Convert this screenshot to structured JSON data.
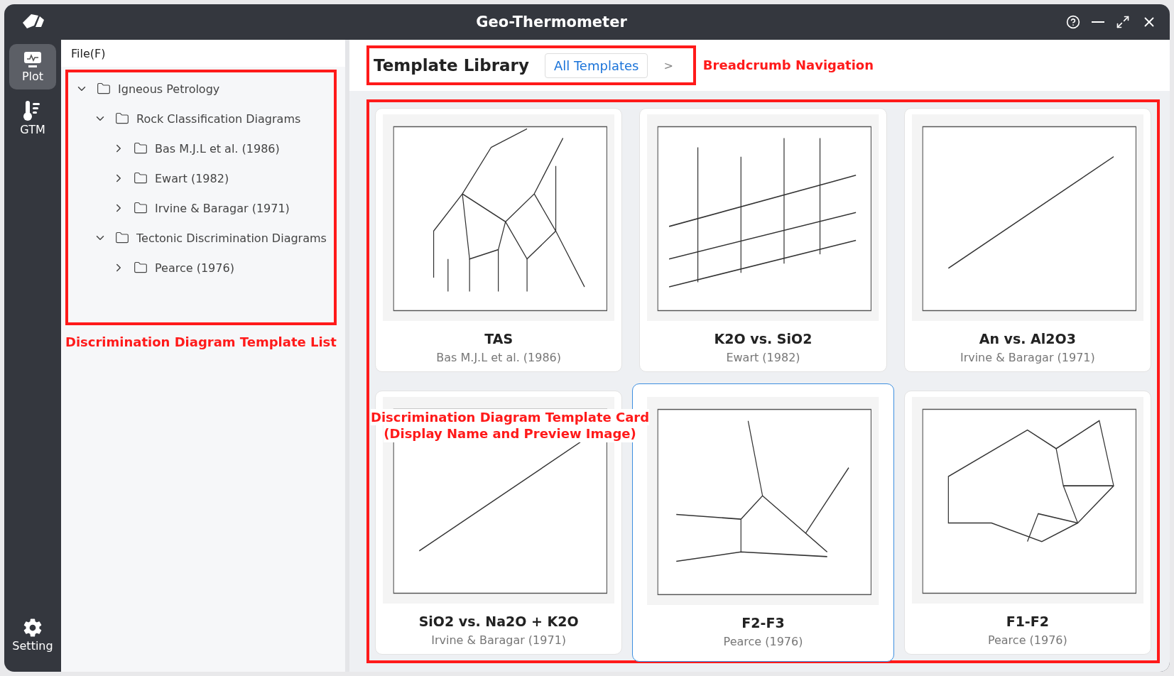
{
  "window": {
    "title": "Geo-Thermometer"
  },
  "nav": [
    {
      "label": "Plot",
      "selected": true
    },
    {
      "label": "GTM",
      "selected": false
    }
  ],
  "nav_bottom": {
    "label": "Setting"
  },
  "menu": [
    "File(F)"
  ],
  "tree": [
    {
      "label": "Igneous Petrology",
      "expanded": true,
      "children": [
        {
          "label": "Rock Classification Diagrams",
          "expanded": true,
          "children": [
            {
              "label": "Bas M.J.L et al. (1986)",
              "expanded": false
            },
            {
              "label": "Ewart (1982)",
              "expanded": false
            },
            {
              "label": "Irvine & Baragar (1971)",
              "expanded": false
            }
          ]
        },
        {
          "label": "Tectonic Discrimination Diagrams",
          "expanded": true,
          "children": [
            {
              "label": "Pearce (1976)",
              "expanded": false
            }
          ]
        }
      ]
    }
  ],
  "breadcrumb": {
    "title": "Template Library",
    "items": [
      {
        "label": "All Templates",
        "selected": true
      }
    ],
    "separator": ">"
  },
  "cards": [
    {
      "title": "TAS",
      "subtitle": "Bas M.J.L et al. (1986)",
      "kind": "tas",
      "selected": false
    },
    {
      "title": "K2O vs. SiO2",
      "subtitle": "Ewart (1982)",
      "kind": "k2o",
      "selected": false
    },
    {
      "title": "An vs. Al2O3",
      "subtitle": "Irvine & Baragar (1971)",
      "kind": "line",
      "selected": false
    },
    {
      "title": "SiO2 vs. Na2O + K2O",
      "subtitle": "Irvine & Baragar (1971)",
      "kind": "line",
      "selected": false
    },
    {
      "title": "F2-F3",
      "subtitle": "Pearce (1976)",
      "kind": "f2f3",
      "selected": true
    },
    {
      "title": "F1-F2",
      "subtitle": "Pearce (1976)",
      "kind": "f1f2",
      "selected": false
    }
  ],
  "annotations": [
    {
      "kind": "tree",
      "lines": [
        "Discrimination Diagram Template List"
      ]
    },
    {
      "kind": "breadcrumb",
      "lines": [
        "Breadcrumb Navigation"
      ]
    },
    {
      "kind": "cards",
      "lines": [
        "Discrimination Diagram Template Card",
        "(Display Name and Preview Image)"
      ]
    }
  ]
}
